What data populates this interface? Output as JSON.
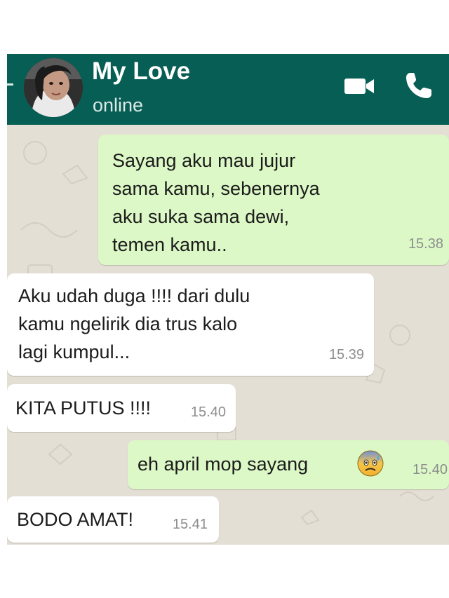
{
  "header": {
    "contact_name": "My Love",
    "status": "online",
    "icons": [
      "back-arrow-icon",
      "avatar",
      "video-call-icon",
      "phone-call-icon"
    ],
    "background_color": "#075e54"
  },
  "messages": [
    {
      "direction": "outgoing",
      "text": "Sayang aku mau jujur\nsama kamu, sebenernya\naku suka sama dewi,\ntemen kamu..",
      "time": "15.38"
    },
    {
      "direction": "incoming",
      "text": "Aku udah duga !!!! dari dulu\nkamu ngelirik dia trus kalo\nlagi kumpul...",
      "time": "15.39"
    },
    {
      "direction": "incoming",
      "text": "KITA PUTUS !!!!",
      "time": "15.40"
    },
    {
      "direction": "outgoing",
      "text": "eh april mop sayang",
      "emoji": "anxious-face-with-sweat-emoji",
      "time": "15.40"
    },
    {
      "direction": "incoming",
      "text": "BODO AMAT!",
      "time": "15.41"
    }
  ],
  "colors": {
    "outgoing_bubble": "#dcf8c6",
    "incoming_bubble": "#ffffff",
    "chat_background": "#e4dfd4",
    "timestamp": "#8d8d8d"
  }
}
